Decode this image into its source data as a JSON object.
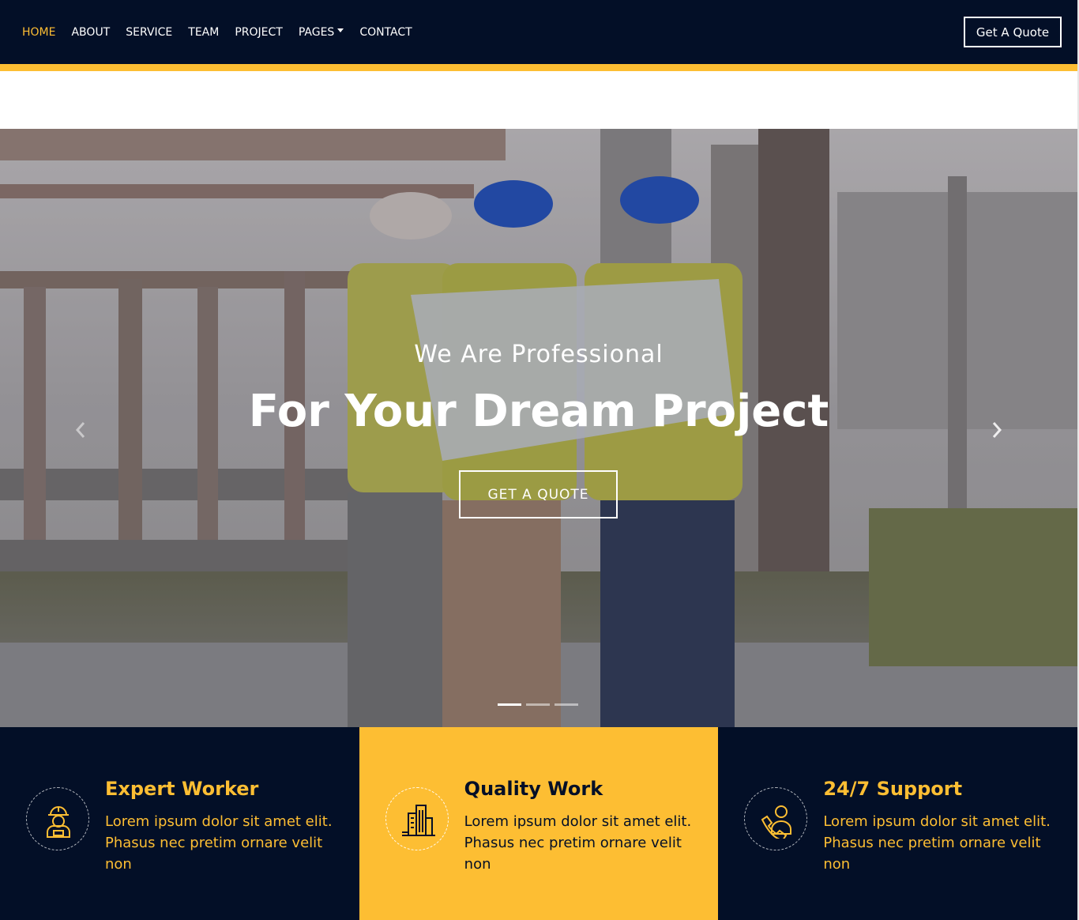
{
  "nav": {
    "links": [
      {
        "label": "HOME",
        "active": true
      },
      {
        "label": "ABOUT"
      },
      {
        "label": "SERVICE"
      },
      {
        "label": "TEAM"
      },
      {
        "label": "PROJECT"
      },
      {
        "label": "PAGES",
        "dropdown": true
      },
      {
        "label": "CONTACT"
      }
    ],
    "cta_label": "Get A Quote"
  },
  "hero": {
    "subtitle": "We Are Professional",
    "title": "For Your Dream Project",
    "button_label": "GET A QUOTE",
    "slides": 3,
    "active_slide": 1
  },
  "features": [
    {
      "title": "Expert Worker",
      "text": "Lorem ipsum dolor sit amet elit. Phasus nec pretim ornare velit non",
      "icon": "worker-icon"
    },
    {
      "title": "Quality Work",
      "text": "Lorem ipsum dolor sit amet elit. Phasus nec pretim ornare velit non",
      "icon": "building-icon"
    },
    {
      "title": "24/7 Support",
      "text": "Lorem ipsum dolor sit amet elit. Phasus nec pretim ornare velit non",
      "icon": "call-support-icon"
    }
  ],
  "colors": {
    "navy": "#030f27",
    "accent": "#fdbe33",
    "white": "#ffffff"
  }
}
